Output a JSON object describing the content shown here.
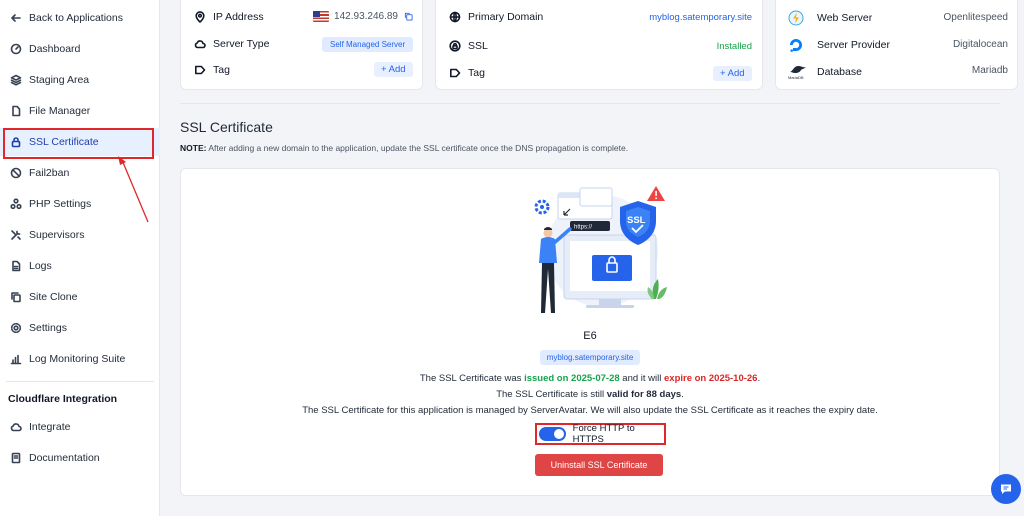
{
  "sidebar": {
    "items": [
      {
        "label": "Back to Applications",
        "icon": "arrow-left-icon"
      },
      {
        "label": "Dashboard",
        "icon": "gauge-icon"
      },
      {
        "label": "Staging Area",
        "icon": "layers-icon"
      },
      {
        "label": "File Manager",
        "icon": "file-icon"
      },
      {
        "label": "SSL Certificate",
        "icon": "lock-icon",
        "active": true
      },
      {
        "label": "Fail2ban",
        "icon": "ban-icon"
      },
      {
        "label": "PHP Settings",
        "icon": "nodes-icon"
      },
      {
        "label": "Supervisors",
        "icon": "tools-icon"
      },
      {
        "label": "Logs",
        "icon": "document-icon"
      },
      {
        "label": "Site Clone",
        "icon": "copy-icon"
      },
      {
        "label": "Settings",
        "icon": "gear-icon"
      },
      {
        "label": "Log Monitoring Suite",
        "icon": "chart-icon"
      }
    ],
    "cloudflare_heading": "Cloudflare Integration",
    "cloudflare_items": [
      {
        "label": "Integrate",
        "icon": "cloud-icon"
      },
      {
        "label": "Documentation",
        "icon": "book-icon"
      }
    ]
  },
  "server_card": {
    "ip_label": "IP Address",
    "ip_value": "142.93.246.89",
    "server_type_label": "Server Type",
    "server_type_value": "Self Managed Server",
    "tag_label": "Tag",
    "add_label": "+ Add"
  },
  "domain_card": {
    "primary_domain_label": "Primary Domain",
    "primary_domain_value": "myblog.satemporary.site",
    "ssl_label": "SSL",
    "ssl_value": "Installed",
    "tag_label": "Tag",
    "add_label": "+ Add"
  },
  "stack_card": {
    "web_server_label": "Web Server",
    "web_server_value": "Openlitespeed",
    "provider_label": "Server Provider",
    "provider_value": "Digitalocean",
    "database_label": "Database",
    "database_value": "Mariadb",
    "mariadb_logo_text": "MariaDB"
  },
  "ssl_section": {
    "title": "SSL Certificate",
    "note_label": "NOTE:",
    "note_text": " After adding a new domain to the application, update the SSL certificate once the DNS propagation is complete.",
    "illustration_url_text": "https://",
    "illustration_badge_text": "SSL",
    "issuer": "E6",
    "domain": "myblog.satemporary.site",
    "line1_a": "The SSL Certificate was ",
    "line1_issued": "issued on 2025-07-28",
    "line1_b": " and it will ",
    "line1_expire": "expire on 2025-10-26",
    "line1_c": ".",
    "line2_a": "The SSL Certificate is still ",
    "line2_valid": "valid for 88 days",
    "line2_b": ".",
    "line3": "The SSL Certificate for this application is managed by ServerAvatar. We will also update the SSL Certificate as it reaches the expiry date.",
    "force_https_label": "Force HTTP to HTTPS",
    "force_https_on": true,
    "uninstall_label": "Uninstall SSL Certificate"
  },
  "colors": {
    "accent": "#2563eb",
    "danger": "#e04545",
    "success": "#16a34a",
    "highlight": "#e0282a"
  }
}
